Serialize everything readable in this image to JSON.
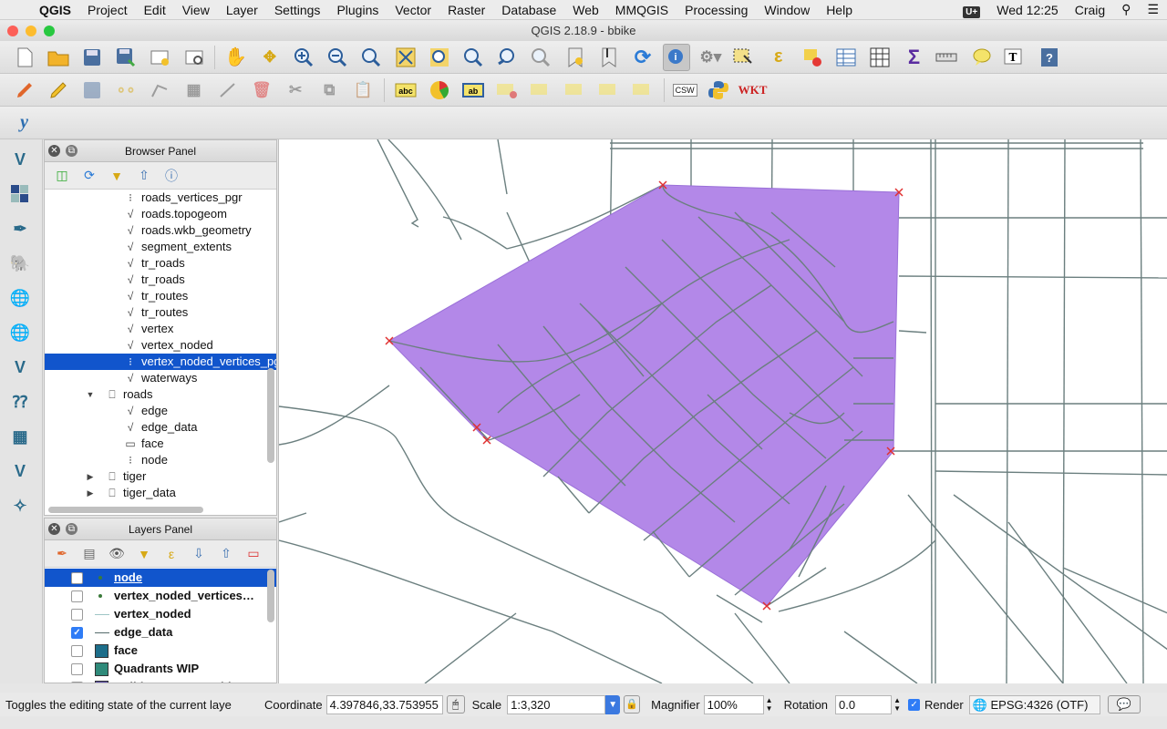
{
  "menubar": {
    "app_name": "QGIS",
    "items": [
      "Project",
      "Edit",
      "View",
      "Layer",
      "Settings",
      "Plugins",
      "Vector",
      "Raster",
      "Database",
      "Web",
      "MMQGIS",
      "Processing",
      "Window",
      "Help"
    ],
    "input_badge": "U+",
    "clock": "Wed 12:25",
    "user": "Craig"
  },
  "window": {
    "title": "QGIS 2.18.9 - bbike"
  },
  "toolbar1": {
    "icons": [
      "new-project-icon",
      "open-project-icon",
      "save-project-icon",
      "save-as-icon",
      "new-print-composer-icon",
      "composer-manager-icon",
      "pan-icon",
      "pan-to-selection-icon",
      "zoom-in-icon",
      "zoom-out-icon",
      "zoom-native-icon",
      "zoom-full-icon",
      "zoom-to-selection-icon",
      "zoom-to-layer-icon",
      "zoom-last-icon",
      "zoom-next-icon",
      "new-bookmark-icon",
      "show-bookmarks-icon",
      "refresh-icon",
      "identify-icon",
      "run-action-icon",
      "select-features-icon",
      "select-by-expression-icon",
      "deselect-icon",
      "attribute-table-icon",
      "field-calculator-icon",
      "statistics-icon",
      "measure-icon",
      "map-tips-icon",
      "text-annotation-icon",
      "help-icon"
    ]
  },
  "toolbar2": {
    "icons": [
      "current-edits-icon",
      "toggle-editing-icon",
      "save-edits-icon",
      "add-feature-icon",
      "add-part-icon",
      "move-feature-icon",
      "node-tool-icon",
      "delete-selected-icon",
      "cut-features-icon",
      "copy-features-icon",
      "paste-features-icon",
      "label-icon",
      "diagram-icon",
      "highlight-pinned-labels-icon",
      "pin-labels-icon",
      "show-hide-labels-icon",
      "move-label-icon",
      "rotate-label-icon",
      "change-label-icon",
      "csw-icon",
      "python-console-icon",
      "wkt-icon"
    ],
    "csw_label": "CSW",
    "wkt_label": "WKT"
  },
  "toolbar3": {
    "icons": [
      "gvsig-icon"
    ]
  },
  "left_tools": [
    "add-vector-layer-icon",
    "add-raster-layer-icon",
    "add-spatialite-layer-icon",
    "add-postgis-layer-icon",
    "add-wms-layer-icon",
    "add-wcs-layer-icon",
    "add-wfs-layer-icon",
    "add-virtual-layer-icon",
    "add-delimited-text-icon",
    "new-shapefile-icon",
    "georeferencer-icon"
  ],
  "browser_panel": {
    "title": "Browser Panel",
    "tools": [
      "add-selected-icon",
      "refresh-icon",
      "filter-icon",
      "collapse-all-icon",
      "properties-icon"
    ],
    "items": [
      {
        "label": "roads_vertices_pgr",
        "type": "point",
        "indent": 2
      },
      {
        "label": "roads.topogeom",
        "type": "line",
        "indent": 2
      },
      {
        "label": "roads.wkb_geometry",
        "type": "line",
        "indent": 2
      },
      {
        "label": "segment_extents",
        "type": "line",
        "indent": 2
      },
      {
        "label": "tr_roads",
        "type": "line",
        "indent": 2
      },
      {
        "label": "tr_roads",
        "type": "line",
        "indent": 2
      },
      {
        "label": "tr_routes",
        "type": "line",
        "indent": 2
      },
      {
        "label": "tr_routes",
        "type": "line",
        "indent": 2
      },
      {
        "label": "vertex",
        "type": "line",
        "indent": 2
      },
      {
        "label": "vertex_noded",
        "type": "line",
        "indent": 2
      },
      {
        "label": "vertex_noded_vertices_pgr",
        "type": "point",
        "indent": 2,
        "selected": true
      },
      {
        "label": "waterways",
        "type": "line",
        "indent": 2
      },
      {
        "label": "roads",
        "type": "schema",
        "indent": 1,
        "expanded": true
      },
      {
        "label": "edge",
        "type": "line",
        "indent": 2
      },
      {
        "label": "edge_data",
        "type": "line",
        "indent": 2
      },
      {
        "label": "face",
        "type": "polygon",
        "indent": 2
      },
      {
        "label": "node",
        "type": "point",
        "indent": 2
      },
      {
        "label": "tiger",
        "type": "schema",
        "indent": 1,
        "expanded": false
      },
      {
        "label": "tiger_data",
        "type": "schema",
        "indent": 1,
        "expanded": false
      }
    ]
  },
  "layers_panel": {
    "title": "Layers Panel",
    "tools": [
      "styling-icon",
      "add-group-icon",
      "manage-visibility-icon",
      "filter-legend-icon",
      "filter-expression-icon",
      "expand-all-icon",
      "collapse-all-icon",
      "remove-layer-icon"
    ],
    "layers": [
      {
        "label": "node",
        "checked": false,
        "symbol": "point",
        "color": "#3a7a3a",
        "selected": true
      },
      {
        "label": "vertex_noded_vertices…",
        "checked": false,
        "symbol": "point",
        "color": "#3a7a3a"
      },
      {
        "label": "vertex_noded",
        "checked": false,
        "symbol": "line",
        "color": "#9ec6c6"
      },
      {
        "label": "edge_data",
        "checked": true,
        "symbol": "line",
        "color": "#556b6b"
      },
      {
        "label": "face",
        "checked": false,
        "symbol": "fill",
        "color": "#1d6e8a"
      },
      {
        "label": "Quadrants WIP",
        "checked": false,
        "symbol": "fill",
        "color": "#2f8a7a"
      },
      {
        "label": "Bulldog_TCU_Corridor",
        "checked": false,
        "symbol": "fill",
        "color": "#5a4aa8"
      }
    ]
  },
  "map": {
    "background": "#ffffff",
    "road_color": "#6b7f7f",
    "polygon_fill": "#b388e8",
    "polygon_stroke": "#9a70d8",
    "marker_color": "#e03030"
  },
  "statusbar": {
    "message": "Toggles the editing state of the current laye",
    "coordinate_label": "Coordinate",
    "coordinate_value": "4.397846,33.753955",
    "scale_label": "Scale",
    "scale_value": "1:3,320",
    "magnifier_label": "Magnifier",
    "magnifier_value": "100%",
    "rotation_label": "Rotation",
    "rotation_value": "0.0",
    "render_label": "Render",
    "render_checked": true,
    "crs": "EPSG:4326 (OTF)"
  }
}
